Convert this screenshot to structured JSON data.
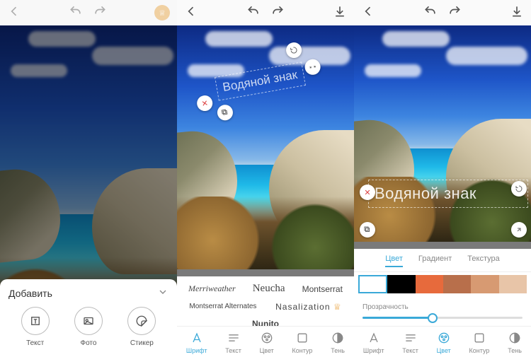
{
  "screen1": {
    "sheet_title": "Добавить",
    "items": [
      "Текст",
      "Фото",
      "Стикер"
    ]
  },
  "screen2": {
    "watermark": "Водяной знак",
    "fonts": [
      "Merriweather",
      "Neucha",
      "Montserrat",
      "Montserrat Alternates",
      "Nasalization",
      "Nunito"
    ],
    "tabs": [
      "Шрифт",
      "Текст",
      "Цвет",
      "Контур",
      "Тень"
    ],
    "active_tab": 0
  },
  "screen3": {
    "watermark": "Водяной знак",
    "color_tabs": [
      "Цвет",
      "Градиент",
      "Текстура"
    ],
    "active_color_tab": 0,
    "swatches": [
      "#ffffff",
      "#000000",
      "#e76a3c",
      "#b86f4b",
      "#d79a72",
      "#e8c5a8"
    ],
    "selected_swatch": 0,
    "opacity_label": "Прозрачность",
    "tabs": [
      "Шрифт",
      "Текст",
      "Цвет",
      "Контур",
      "Тень"
    ],
    "active_tab": 2
  },
  "icons": {
    "back": "back-icon",
    "undo": "undo-icon",
    "redo": "redo-icon",
    "download": "download-icon",
    "crown": "crown-icon",
    "chevron": "chevron-down-icon",
    "text": "text-icon",
    "photo": "photo-icon",
    "sticker": "sticker-icon",
    "close": "close-icon",
    "rotate": "rotate-icon",
    "move": "move-icon",
    "copy": "copy-icon",
    "font": "font-icon",
    "textline": "textline-icon",
    "palette": "palette-icon",
    "outline": "outline-icon",
    "shadow": "shadow-icon"
  }
}
